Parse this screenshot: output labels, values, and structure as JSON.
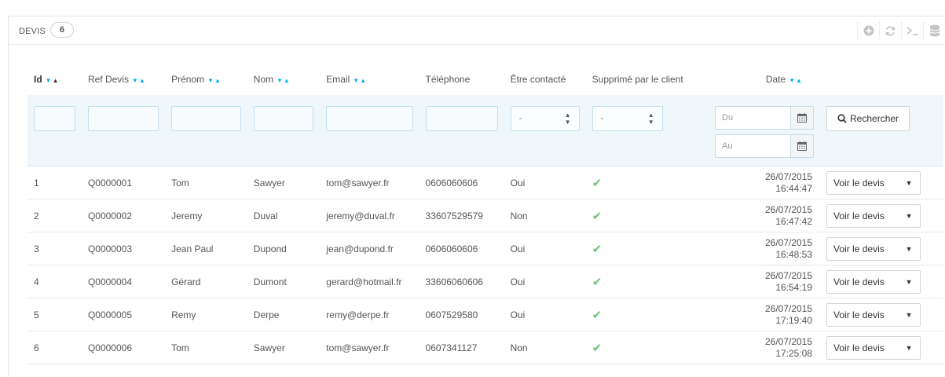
{
  "panel": {
    "title": "DEVIS",
    "count": "6"
  },
  "toolbar_icons": [
    "add-circle-icon",
    "refresh-icon",
    "terminal-icon",
    "database-icon"
  ],
  "columns": {
    "id": "Id",
    "ref": "Ref Devis",
    "prenom": "Prénom",
    "nom": "Nom",
    "email": "Email",
    "telephone": "Téléphone",
    "contacte": "Être contacté",
    "supprime": "Supprimé par le client",
    "date": "Date"
  },
  "filters": {
    "contacte_value": "-",
    "supprime_value": "-",
    "date_from_placeholder": "Du",
    "date_to_placeholder": "Au",
    "search_label": "Rechercher"
  },
  "rows": [
    {
      "id": "1",
      "ref": "Q0000001",
      "prenom": "Tom",
      "nom": "Sawyer",
      "email": "tom@sawyer.fr",
      "tel": "0606060606",
      "contacte": "Oui",
      "date": "26/07/2015",
      "time": "16:44:47",
      "action": "Voir le devis"
    },
    {
      "id": "2",
      "ref": "Q0000002",
      "prenom": "Jeremy",
      "nom": "Duval",
      "email": "jeremy@duval.fr",
      "tel": "33607529579",
      "contacte": "Non",
      "date": "26/07/2015",
      "time": "16:47:42",
      "action": "Voir le devis"
    },
    {
      "id": "3",
      "ref": "Q0000003",
      "prenom": "Jean Paul",
      "nom": "Dupond",
      "email": "jean@dupond.fr",
      "tel": "0606060606",
      "contacte": "Oui",
      "date": "26/07/2015",
      "time": "16:48:53",
      "action": "Voir le devis"
    },
    {
      "id": "4",
      "ref": "Q0000004",
      "prenom": "Gérard",
      "nom": "Dumont",
      "email": "gerard@hotmail.fr",
      "tel": "33606060606",
      "contacte": "Oui",
      "date": "26/07/2015",
      "time": "16:54:19",
      "action": "Voir le devis"
    },
    {
      "id": "5",
      "ref": "Q0000005",
      "prenom": "Remy",
      "nom": "Derpe",
      "email": "remy@derpe.fr",
      "tel": "0607529580",
      "contacte": "Oui",
      "date": "26/07/2015",
      "time": "17:19:40",
      "action": "Voir le devis"
    },
    {
      "id": "6",
      "ref": "Q0000006",
      "prenom": "Tom",
      "nom": "Sawyer",
      "email": "tom@sawyer.fr",
      "tel": "0607341127",
      "contacte": "Non",
      "date": "26/07/2015",
      "time": "17:25:08",
      "action": "Voir le devis"
    }
  ],
  "colors": {
    "accent": "#00aff0",
    "check": "#72c279",
    "filter_bg": "#eff7fb"
  }
}
